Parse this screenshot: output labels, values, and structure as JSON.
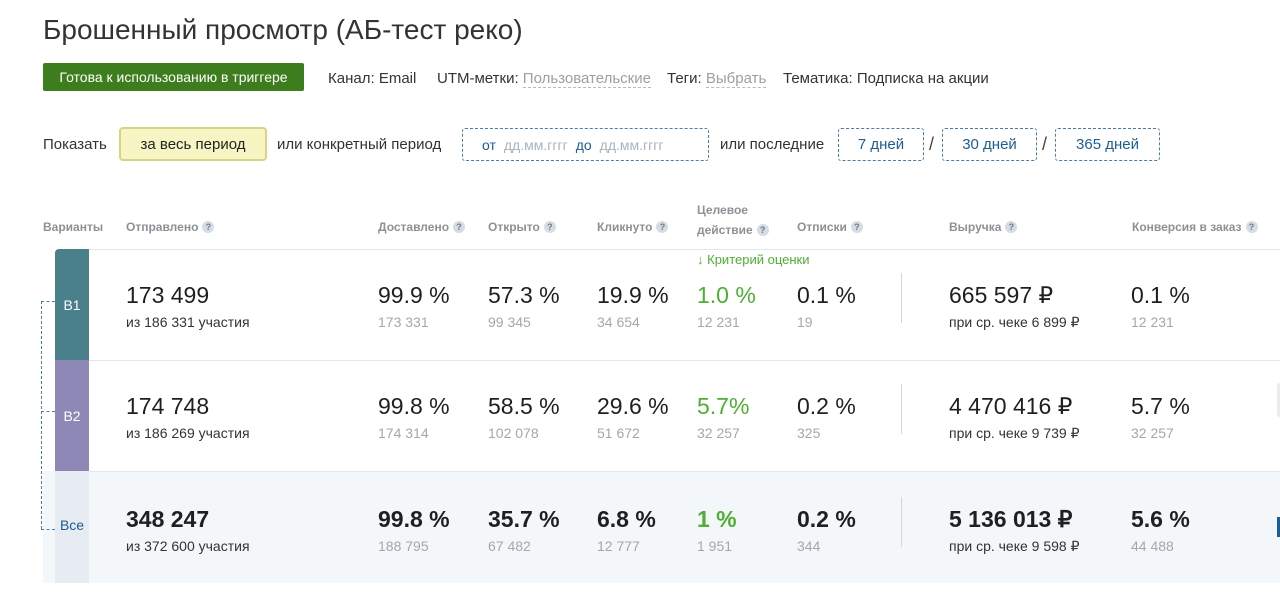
{
  "page": {
    "title": "Брошенный просмотр (АБ-тест реко)",
    "status": "Готова к использованию в триггере",
    "channel": {
      "label": "Канал:",
      "value": "Email"
    },
    "utm": {
      "label": "UTM-метки:",
      "value": "Пользовательские"
    },
    "tags": {
      "label": "Теги:",
      "value": "Выбрать"
    },
    "topic": {
      "label": "Тематика:",
      "value": "Подписка на акции"
    }
  },
  "filters": {
    "show_label": "Показать",
    "all_period": "за весь период",
    "specific_label": "или конкретный период",
    "from_label": "от",
    "from_placeholder": "дд.мм.гггг",
    "to_label": "до",
    "to_placeholder": "дд.мм.гггг",
    "last_label": "или последние",
    "days": [
      "7 дней",
      "30 дней",
      "365 дней"
    ],
    "separator": "/"
  },
  "table": {
    "headers": {
      "variants": "Варианты",
      "sent": "Отправлено",
      "delivered": "Доставлено",
      "opened": "Открыто",
      "clicked": "Кликнуто",
      "target_line1": "Целевое",
      "target_line2": "действие",
      "unsub": "Отписки",
      "revenue": "Выручка",
      "conversion": "Конверсия в заказ",
      "help": "?"
    },
    "criterion": "Критерий оценки",
    "criterion_arrow": "↓",
    "rows": [
      {
        "variant": "B1",
        "color": "#4a7f8c",
        "sent": "173 499",
        "sent_sub": "из 186 331 участия",
        "delivered": "99.9 %",
        "delivered_sub": "173 331",
        "opened": "57.3 %",
        "opened_sub": "99 345",
        "clicked": "19.9 %",
        "clicked_sub": "34 654",
        "target": "1.0 %",
        "target_sub": "12 231",
        "unsub": "0.1 %",
        "unsub_sub": "19",
        "revenue": "665 597 ₽",
        "revenue_sub": "при ср. чеке 6 899 ₽",
        "conversion": "0.1 %",
        "conversion_sub": "12 231"
      },
      {
        "variant": "B2",
        "color": "#8d88b6",
        "sent": "174 748",
        "sent_sub": "из 186 269 участия",
        "delivered": "99.8 %",
        "delivered_sub": "174 314",
        "opened": "58.5 %",
        "opened_sub": "102 078",
        "clicked": "29.6 %",
        "clicked_sub": "51 672",
        "target": "5.7%",
        "target_sub": "32 257",
        "unsub": "0.2 %",
        "unsub_sub": "325",
        "revenue": "4 470 416 ₽",
        "revenue_sub": "при ср. чеке 9 739 ₽",
        "conversion": "5.7 %",
        "conversion_sub": "32 257"
      },
      {
        "variant": "Все",
        "color": "#e6ecf2",
        "sent": "348 247",
        "sent_sub": "из 372 600 участия",
        "delivered": "99.8 %",
        "delivered_sub": "188 795",
        "opened": "35.7 %",
        "opened_sub": "67 482",
        "clicked": "6.8 %",
        "clicked_sub": "12 777",
        "target": "1 %",
        "target_sub": "1 951",
        "unsub": "0.2 %",
        "unsub_sub": "344",
        "revenue": "5 136 013 ₽",
        "revenue_sub": "при ср. чеке 9 598 ₽",
        "conversion": "5.6 %",
        "conversion_sub": "44 488"
      }
    ]
  },
  "colors": {
    "accent_green": "#4fae33",
    "status_bg": "#3e7d1e",
    "link_blue": "#1f5c94",
    "total_bg": "#f3f7fa"
  }
}
